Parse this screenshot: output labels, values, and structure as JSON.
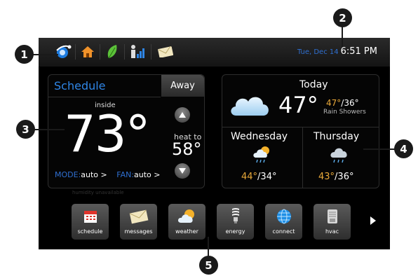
{
  "topbar": {
    "icons": [
      "swirl-logo-icon",
      "home-icon",
      "leaf-icon",
      "signal-bars-icon",
      "envelope-icon"
    ],
    "date": "Tue, Dec 14",
    "time": "6:51 PM"
  },
  "schedule": {
    "title": "Schedule",
    "away_label": "Away",
    "inside_label": "inside",
    "temperature": "73°",
    "humidity": "humidity unavailable",
    "heat_to_label": "heat to",
    "heat_setpoint": "58°",
    "mode_label": "MODE:",
    "mode_value": "auto >",
    "fan_label": "FAN:",
    "fan_value": "auto >"
  },
  "weather": {
    "today_label": "Today",
    "today_temp": "47°",
    "today_high": "47°",
    "today_low": "/36°",
    "today_condition": "Rain Showers",
    "days": [
      {
        "name": "Wednesday",
        "high": "44°",
        "low": "/34°"
      },
      {
        "name": "Thursday",
        "high": "43°",
        "low": "/36°"
      }
    ]
  },
  "dock": {
    "items": [
      {
        "label": "schedule",
        "icon": "calendar-icon"
      },
      {
        "label": "messages",
        "icon": "envelope-icon"
      },
      {
        "label": "weather",
        "icon": "sun-cloud-icon"
      },
      {
        "label": "energy",
        "icon": "light-bulb-icon"
      },
      {
        "label": "connect",
        "icon": "globe-icon"
      },
      {
        "label": "hvac",
        "icon": "hvac-unit-icon"
      }
    ]
  },
  "callouts": [
    "1",
    "2",
    "3",
    "4",
    "5"
  ],
  "colors": {
    "accent_blue": "#2f6fd0",
    "orange": "#e9a93a",
    "screen_bg": "#000000"
  }
}
